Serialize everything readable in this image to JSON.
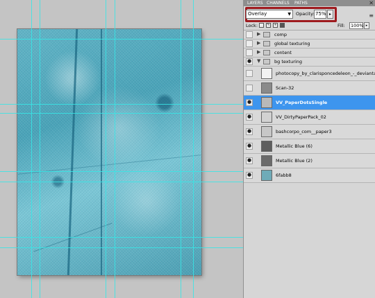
{
  "panel": {
    "tabs": [
      "LAYERS",
      "CHANNELS",
      "PATHS"
    ],
    "close_icon": "close-icon",
    "options": {
      "blend_mode": "Overlay",
      "opacity_label": "Opacity:",
      "opacity_value": "75%"
    },
    "lock": {
      "label": "Lock:",
      "fill_label": "Fill:",
      "fill_value": "100%"
    },
    "layers": [
      {
        "type": "group",
        "name": "comp",
        "visible": false,
        "expanded": false
      },
      {
        "type": "group",
        "name": "global texturing",
        "visible": false,
        "expanded": false
      },
      {
        "type": "group",
        "name": "content",
        "visible": false,
        "expanded": false
      },
      {
        "type": "group",
        "name": "bg texturing",
        "visible": true,
        "expanded": true
      },
      {
        "type": "image",
        "name": "photocopy_by_clarisponcedeleon_-_deviantart",
        "visible": false,
        "selected": false,
        "thumb_color": "#f2f2f2"
      },
      {
        "type": "image",
        "name": "Scan-32",
        "visible": false,
        "selected": false,
        "thumb_color": "#8a8a8a"
      },
      {
        "type": "image",
        "name": "VV_PaperDotsSingle",
        "visible": true,
        "selected": true,
        "thumb_color": "#b9b9b9"
      },
      {
        "type": "image",
        "name": "VV_DirtyPaperPack_02",
        "visible": true,
        "selected": false,
        "thumb_color": "#d2d2d2"
      },
      {
        "type": "image",
        "name": "bashcorpo_com__paper3",
        "visible": true,
        "selected": false,
        "thumb_color": "#c7c7c7"
      },
      {
        "type": "image",
        "name": "Metallic Blue (6)",
        "visible": true,
        "selected": false,
        "thumb_color": "#5e5e5e"
      },
      {
        "type": "image",
        "name": "Metallic Blue (2)",
        "visible": true,
        "selected": false,
        "thumb_color": "#6b6b6b"
      },
      {
        "type": "image",
        "name": "6fabb8",
        "visible": true,
        "selected": false,
        "thumb_color": "#6fabb8"
      }
    ]
  },
  "colors": {
    "highlight_border": "#9e1a1e",
    "selection": "#3d95ee",
    "guides": "#37e6e6",
    "document_fill": "#6fabb8"
  }
}
